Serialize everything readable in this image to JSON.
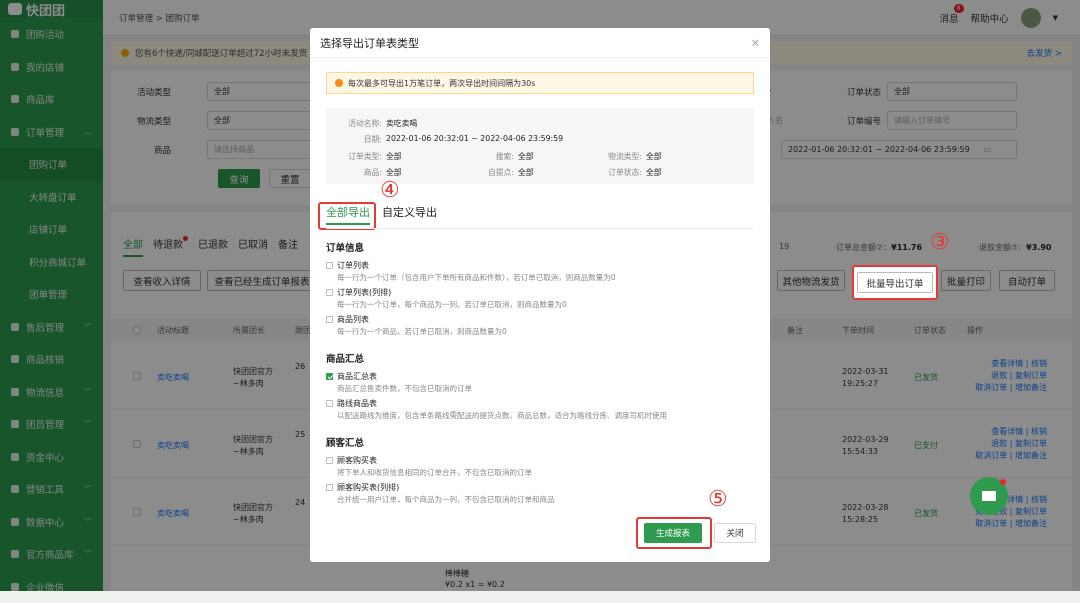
{
  "app": {
    "logo": "快团团"
  },
  "sidebar": {
    "items": [
      {
        "label": "团购活动",
        "icon": "flag-icon",
        "arrow": ""
      },
      {
        "label": "我的店铺",
        "icon": "shop-icon",
        "arrow": ""
      },
      {
        "label": "商品库",
        "icon": "box-icon",
        "arrow": ""
      },
      {
        "label": "订单管理",
        "icon": "order-icon",
        "arrow": "^"
      },
      {
        "label": "团购订单",
        "icon": "",
        "arrow": "",
        "sub": true,
        "active": true
      },
      {
        "label": "大转盘订单",
        "icon": "",
        "arrow": "",
        "sub": true
      },
      {
        "label": "店铺订单",
        "icon": "",
        "arrow": "",
        "sub": true
      },
      {
        "label": "积分商城订单",
        "icon": "",
        "arrow": "",
        "sub": true
      },
      {
        "label": "团单管理",
        "icon": "",
        "arrow": "",
        "sub": true
      },
      {
        "label": "售后管理",
        "icon": "refund-icon",
        "arrow": "v"
      },
      {
        "label": "商品核销",
        "icon": "lock-icon",
        "arrow": ""
      },
      {
        "label": "物流信息",
        "icon": "truck-icon",
        "arrow": "v"
      },
      {
        "label": "团员管理",
        "icon": "user-icon",
        "arrow": "v"
      },
      {
        "label": "资金中心",
        "icon": "money-icon",
        "arrow": ""
      },
      {
        "label": "营销工具",
        "icon": "tag-icon",
        "arrow": "v"
      },
      {
        "label": "数据中心",
        "icon": "chart-icon",
        "arrow": "v"
      },
      {
        "label": "官方商品库",
        "icon": "heart-icon",
        "arrow": "v"
      },
      {
        "label": "企业微信",
        "icon": "wechat-icon",
        "arrow": ""
      }
    ]
  },
  "header": {
    "breadcrumb": "订单管理 > 团购订单",
    "messages": "消息",
    "msg_count": "8",
    "help": "帮助中心"
  },
  "notice": {
    "text": "您有6个快递/同城配送订单超过72小时未发货",
    "action": "去发货 >"
  },
  "filters": {
    "activity_type_label": "活动类型",
    "activity_type": "全部",
    "logistics_type_label": "物流类型",
    "logistics_type": "全部",
    "goods_label": "商品",
    "goods_placeholder": "请选择商品",
    "status_label": "订单状态",
    "status": "全部",
    "order_no_label": "订单编号",
    "order_no_placeholder": "请输入订单编号",
    "partial_a": "",
    "partial_b": "",
    "partial_c": "人名",
    "date_range": "2022-01-06 20:32:01 ~ 2022-04-06 23:59:59",
    "query": "查询",
    "reset": "重置"
  },
  "tabs": [
    "全部",
    "待退款",
    "已退款",
    "已取消",
    "备注"
  ],
  "stats": {
    "count_tail": "19",
    "total_label": "订单总金额⑦：",
    "total": "¥11.76",
    "refund_label": "退款金额⑦：",
    "refund": "¥3.90"
  },
  "actions": {
    "income": "查看收入详情",
    "generated": "查看已经生成订单报表",
    "other_ship": "其他物流发货",
    "batch_export": "批量导出订单",
    "batch_print": "批量打印",
    "auto_print": "自动打单"
  },
  "table": {
    "headers": [
      "活动标题",
      "所属团长",
      "跟团",
      "备注",
      "下单时间",
      "订单状态",
      "操作"
    ],
    "rows": [
      {
        "title": "卖吃卖喝",
        "leader": "快团团官方~林多肉",
        "num": "26",
        "time": "2022-03-31 19:25:27",
        "status": "已发货",
        "ops": [
          "查看详情 | 核销",
          "退款 | 复制订单",
          "取消订单 | 增加备注"
        ]
      },
      {
        "title": "卖吃卖喝",
        "leader": "快团团官方~林多肉",
        "num": "25",
        "time": "2022-03-29 15:54:33",
        "status": "已支付",
        "ops": [
          "查看详情 | 核销",
          "退款 | 复制订单",
          "取消订单 | 增加备注"
        ]
      },
      {
        "title": "卖吃卖喝",
        "leader": "快团团官方~林多肉",
        "num": "24",
        "time": "2022-03-28 15:28:25",
        "status": "已发货",
        "ops": [
          "查看详情 | 核销",
          "处理退款 | 复制订单",
          "取消订单 | 增加备注"
        ]
      }
    ],
    "extra_item": "棒棒糖",
    "extra_price": "¥0.2 x1 = ¥0.2"
  },
  "annotations": {
    "n3": "③",
    "n4": "④",
    "n5": "⑤"
  },
  "modal": {
    "title": "选择导出订单表类型",
    "close": "×",
    "warning": "每次最多可导出1万笔订单，两次导出时间间隔为30s",
    "info": {
      "activity_label": "活动名称:",
      "activity": "卖吃卖喝",
      "date_label": "日期:",
      "date": "2022-01-06 20:32:01 ~ 2022-04-06 23:59:59",
      "order_type_label": "订单类型:",
      "order_type": "全部",
      "search_label": "搜索:",
      "search": "全部",
      "logistics_label": "物流类型:",
      "logistics": "全部",
      "goods_label": "商品:",
      "goods": "全部",
      "pickup_label": "自提点:",
      "pickup": "全部",
      "status_label": "订单状态:",
      "status": "全部"
    },
    "tabs": [
      "全部导出",
      "自定义导出"
    ],
    "sections": [
      {
        "title": "订单信息",
        "options": [
          {
            "name": "订单列表",
            "desc": "每一行为一个订单（包含用户下单所有商品和件数），若订单已取消，则商品数量为0",
            "checked": false
          },
          {
            "name": "订单列表(列排)",
            "desc": "每一行为一个订单，每个商品为一列。若订单已取消，则商品数量为0",
            "checked": false
          },
          {
            "name": "商品列表",
            "desc": "每一行为一个商品，若订单已取消，则商品数量为0",
            "checked": false
          }
        ]
      },
      {
        "title": "商品汇总",
        "options": [
          {
            "name": "商品汇总表",
            "desc": "商品汇总售卖件数，不包含已取消的订单",
            "checked": true
          },
          {
            "name": "路线商品表",
            "desc": "以配送路线为维度，包含单条路线需配送的提货点数、商品总数，适合为路线分拣、调度司机时使用",
            "checked": false
          }
        ]
      },
      {
        "title": "顾客汇总",
        "options": [
          {
            "name": "顾客购买表",
            "desc": "将下单人和收货信息相同的订单合并，不包含已取消的订单",
            "checked": false
          },
          {
            "name": "顾客购买表(列排)",
            "desc": "合并统一用户订单，每个商品为一列，不包含已取消的订单和商品",
            "checked": false
          }
        ]
      }
    ],
    "generate": "生成报表",
    "close_btn": "关闭"
  }
}
